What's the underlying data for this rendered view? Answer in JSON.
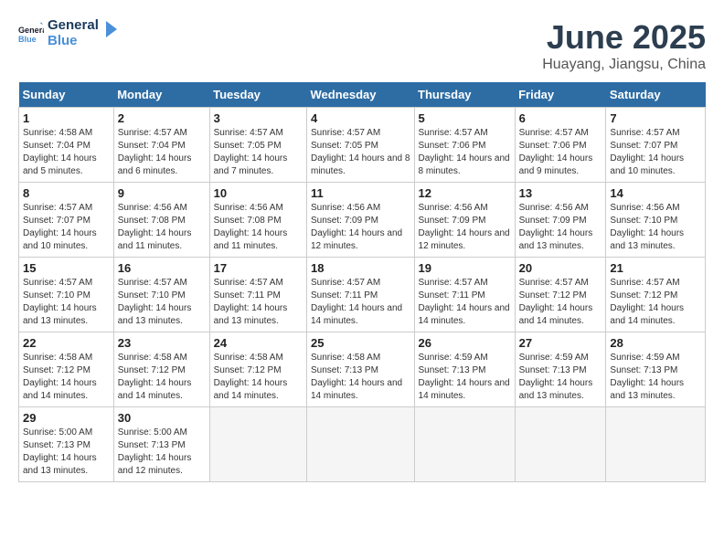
{
  "header": {
    "logo_general": "General",
    "logo_blue": "Blue",
    "title": "June 2025",
    "subtitle": "Huayang, Jiangsu, China"
  },
  "weekdays": [
    "Sunday",
    "Monday",
    "Tuesday",
    "Wednesday",
    "Thursday",
    "Friday",
    "Saturday"
  ],
  "weeks": [
    [
      {
        "day": 1,
        "sunrise": "4:58 AM",
        "sunset": "7:04 PM",
        "daylight": "14 hours and 5 minutes."
      },
      {
        "day": 2,
        "sunrise": "4:57 AM",
        "sunset": "7:04 PM",
        "daylight": "14 hours and 6 minutes."
      },
      {
        "day": 3,
        "sunrise": "4:57 AM",
        "sunset": "7:05 PM",
        "daylight": "14 hours and 7 minutes."
      },
      {
        "day": 4,
        "sunrise": "4:57 AM",
        "sunset": "7:05 PM",
        "daylight": "14 hours and 8 minutes."
      },
      {
        "day": 5,
        "sunrise": "4:57 AM",
        "sunset": "7:06 PM",
        "daylight": "14 hours and 8 minutes."
      },
      {
        "day": 6,
        "sunrise": "4:57 AM",
        "sunset": "7:06 PM",
        "daylight": "14 hours and 9 minutes."
      },
      {
        "day": 7,
        "sunrise": "4:57 AM",
        "sunset": "7:07 PM",
        "daylight": "14 hours and 10 minutes."
      }
    ],
    [
      {
        "day": 8,
        "sunrise": "4:57 AM",
        "sunset": "7:07 PM",
        "daylight": "14 hours and 10 minutes."
      },
      {
        "day": 9,
        "sunrise": "4:56 AM",
        "sunset": "7:08 PM",
        "daylight": "14 hours and 11 minutes."
      },
      {
        "day": 10,
        "sunrise": "4:56 AM",
        "sunset": "7:08 PM",
        "daylight": "14 hours and 11 minutes."
      },
      {
        "day": 11,
        "sunrise": "4:56 AM",
        "sunset": "7:09 PM",
        "daylight": "14 hours and 12 minutes."
      },
      {
        "day": 12,
        "sunrise": "4:56 AM",
        "sunset": "7:09 PM",
        "daylight": "14 hours and 12 minutes."
      },
      {
        "day": 13,
        "sunrise": "4:56 AM",
        "sunset": "7:09 PM",
        "daylight": "14 hours and 13 minutes."
      },
      {
        "day": 14,
        "sunrise": "4:56 AM",
        "sunset": "7:10 PM",
        "daylight": "14 hours and 13 minutes."
      }
    ],
    [
      {
        "day": 15,
        "sunrise": "4:57 AM",
        "sunset": "7:10 PM",
        "daylight": "14 hours and 13 minutes."
      },
      {
        "day": 16,
        "sunrise": "4:57 AM",
        "sunset": "7:10 PM",
        "daylight": "14 hours and 13 minutes."
      },
      {
        "day": 17,
        "sunrise": "4:57 AM",
        "sunset": "7:11 PM",
        "daylight": "14 hours and 13 minutes."
      },
      {
        "day": 18,
        "sunrise": "4:57 AM",
        "sunset": "7:11 PM",
        "daylight": "14 hours and 14 minutes."
      },
      {
        "day": 19,
        "sunrise": "4:57 AM",
        "sunset": "7:11 PM",
        "daylight": "14 hours and 14 minutes."
      },
      {
        "day": 20,
        "sunrise": "4:57 AM",
        "sunset": "7:12 PM",
        "daylight": "14 hours and 14 minutes."
      },
      {
        "day": 21,
        "sunrise": "4:57 AM",
        "sunset": "7:12 PM",
        "daylight": "14 hours and 14 minutes."
      }
    ],
    [
      {
        "day": 22,
        "sunrise": "4:58 AM",
        "sunset": "7:12 PM",
        "daylight": "14 hours and 14 minutes."
      },
      {
        "day": 23,
        "sunrise": "4:58 AM",
        "sunset": "7:12 PM",
        "daylight": "14 hours and 14 minutes."
      },
      {
        "day": 24,
        "sunrise": "4:58 AM",
        "sunset": "7:12 PM",
        "daylight": "14 hours and 14 minutes."
      },
      {
        "day": 25,
        "sunrise": "4:58 AM",
        "sunset": "7:13 PM",
        "daylight": "14 hours and 14 minutes."
      },
      {
        "day": 26,
        "sunrise": "4:59 AM",
        "sunset": "7:13 PM",
        "daylight": "14 hours and 14 minutes."
      },
      {
        "day": 27,
        "sunrise": "4:59 AM",
        "sunset": "7:13 PM",
        "daylight": "14 hours and 13 minutes."
      },
      {
        "day": 28,
        "sunrise": "4:59 AM",
        "sunset": "7:13 PM",
        "daylight": "14 hours and 13 minutes."
      }
    ],
    [
      {
        "day": 29,
        "sunrise": "5:00 AM",
        "sunset": "7:13 PM",
        "daylight": "14 hours and 13 minutes."
      },
      {
        "day": 30,
        "sunrise": "5:00 AM",
        "sunset": "7:13 PM",
        "daylight": "14 hours and 12 minutes."
      },
      null,
      null,
      null,
      null,
      null
    ]
  ]
}
